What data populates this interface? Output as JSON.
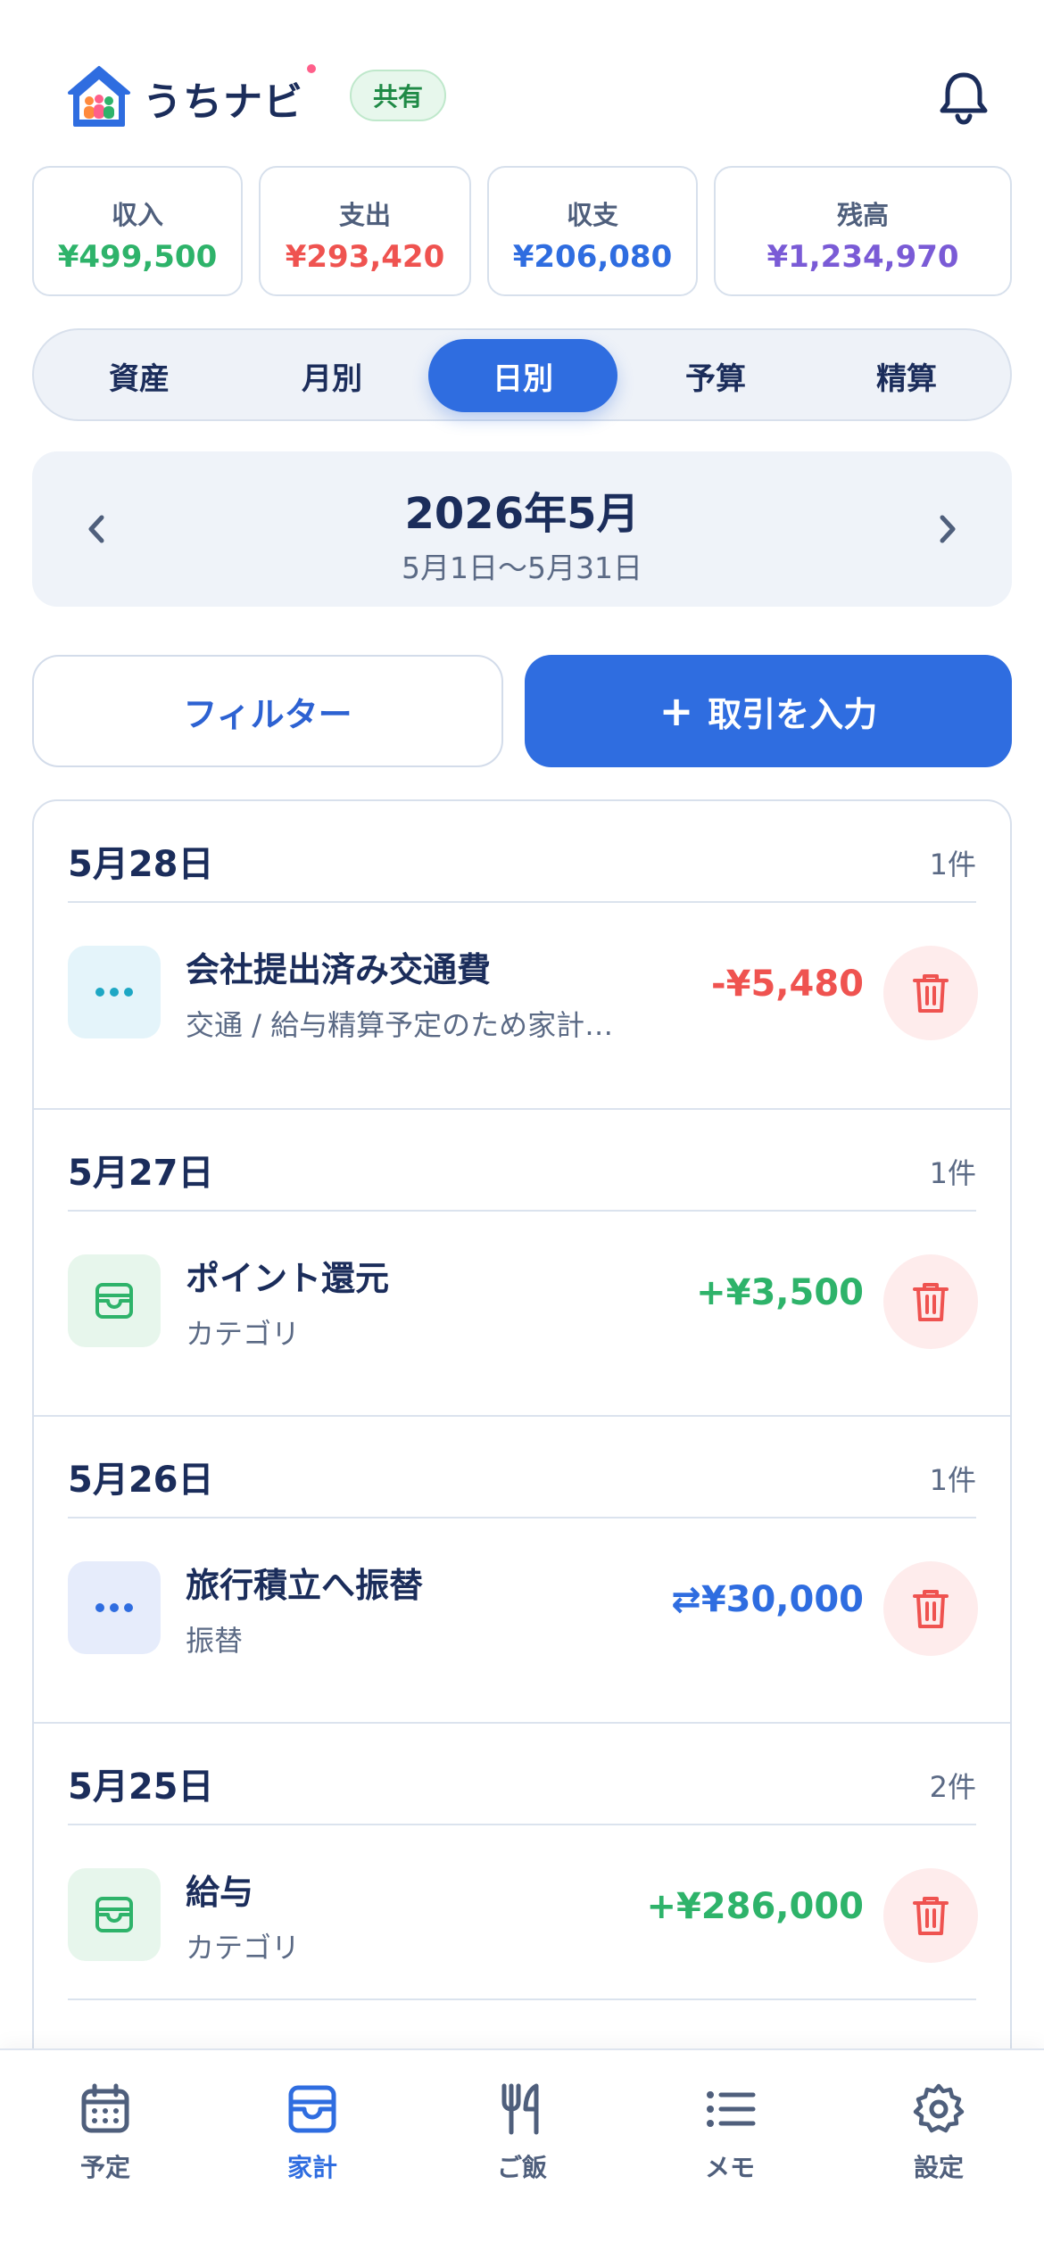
{
  "header": {
    "app_name": "うちナビ",
    "share_badge": "共有"
  },
  "summary": [
    {
      "label": "収入",
      "value": "¥499,500",
      "color": "#2eb36a"
    },
    {
      "label": "支出",
      "value": "¥293,420",
      "color": "#ef5350"
    },
    {
      "label": "収支",
      "value": "¥206,080",
      "color": "#2f6de0"
    },
    {
      "label": "残高",
      "value": "¥1,234,970",
      "color": "#7a5bd6"
    }
  ],
  "tabs": [
    {
      "label": "資産",
      "active": false
    },
    {
      "label": "月別",
      "active": false
    },
    {
      "label": "日別",
      "active": true
    },
    {
      "label": "予算",
      "active": false
    },
    {
      "label": "精算",
      "active": false
    }
  ],
  "month": {
    "title": "2026年5月",
    "range": "5月1日〜5月31日"
  },
  "actions": {
    "filter_label": "フィルター",
    "add_plus": "+",
    "add_label": "取引を入力"
  },
  "groups": [
    {
      "date": "5月28日",
      "count": "1件",
      "item": {
        "title": "会社提出済み交通費",
        "sub": "交通 / 給与精算予定のため家計…",
        "amount": "-¥5,480",
        "amount_color": "#ef5350",
        "icon": "more-icon",
        "icon_bg": "#e4f4fa",
        "icon_color": "#1ea7c4"
      }
    },
    {
      "date": "5月27日",
      "count": "1件",
      "item": {
        "title": "ポイント還元",
        "sub": "カテゴリ",
        "amount": "+¥3,500",
        "amount_color": "#2eb36a",
        "icon": "wallet-icon",
        "icon_bg": "#e7f6ec",
        "icon_color": "#2eb36a"
      }
    },
    {
      "date": "5月26日",
      "count": "1件",
      "item": {
        "title": "旅行積立へ振替",
        "sub": "振替",
        "amount": "⇄¥30,000",
        "amount_color": "#2f6de0",
        "icon": "more-icon",
        "icon_bg": "#e6ecfb",
        "icon_color": "#2f6de0"
      }
    },
    {
      "date": "5月25日",
      "count": "2件",
      "item": {
        "title": "給与",
        "sub": "カテゴリ",
        "amount": "+¥286,000",
        "amount_color": "#2eb36a",
        "icon": "wallet-icon",
        "icon_bg": "#e7f6ec",
        "icon_color": "#2eb36a"
      }
    }
  ],
  "nav": [
    {
      "label": "予定",
      "icon": "calendar-icon",
      "active": false
    },
    {
      "label": "家計",
      "icon": "wallet-icon",
      "active": true
    },
    {
      "label": "ご飯",
      "icon": "fork-knife-icon",
      "active": false
    },
    {
      "label": "メモ",
      "icon": "list-icon",
      "active": false
    },
    {
      "label": "設定",
      "icon": "gear-icon",
      "active": false
    }
  ]
}
